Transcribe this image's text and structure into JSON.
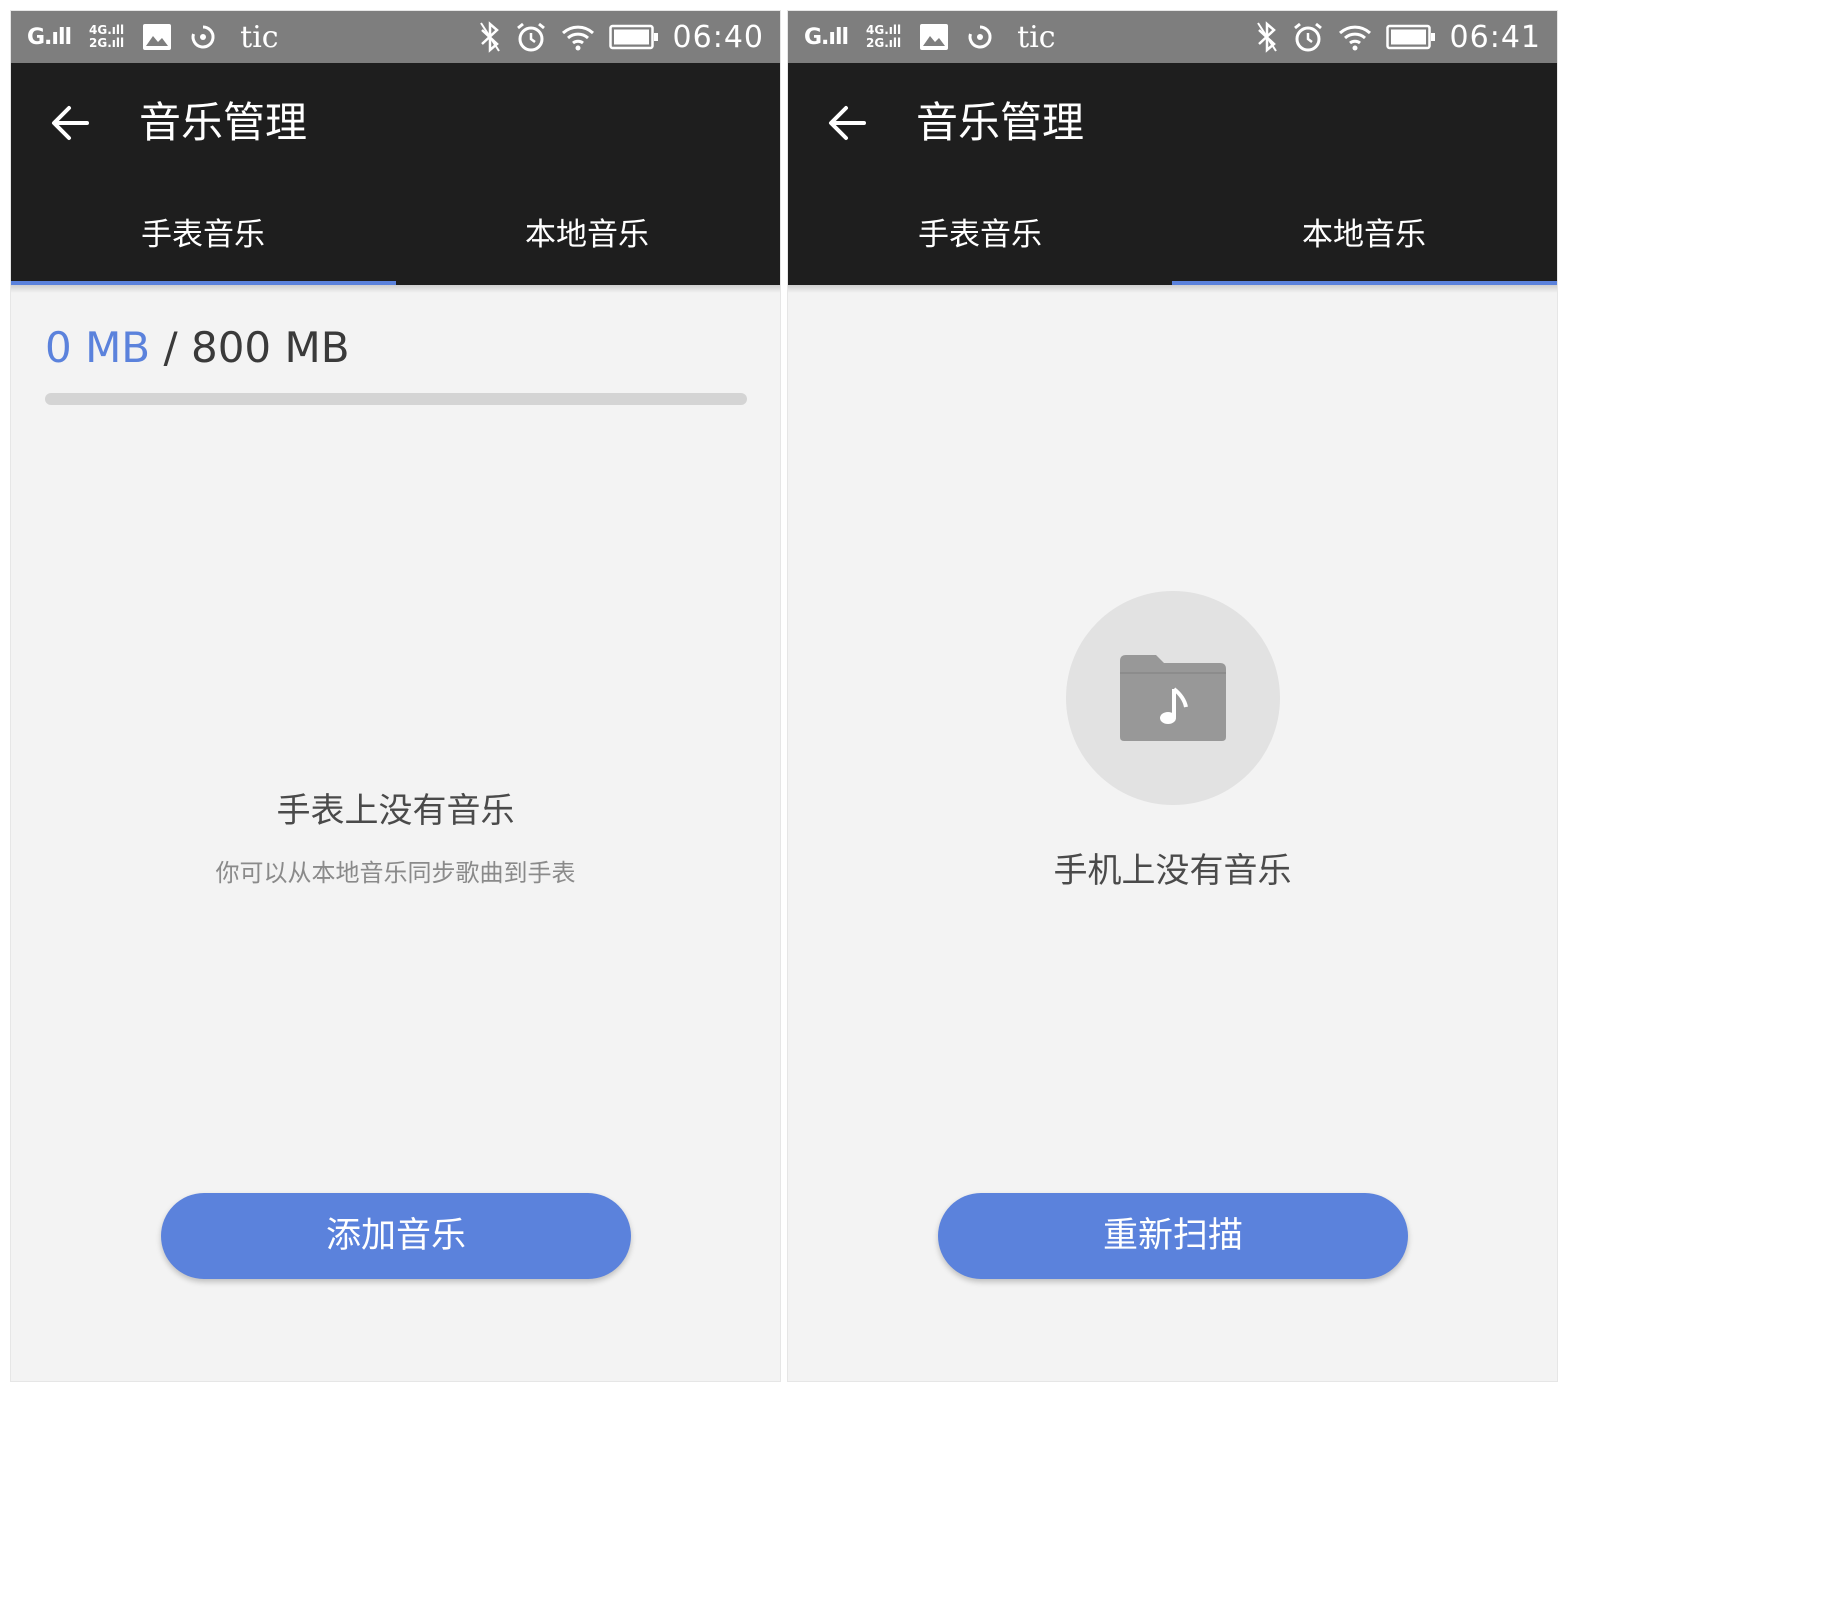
{
  "left": {
    "status_bar": {
      "signal_1": "G.ıll",
      "signal_2_top": "4G.ıll",
      "signal_2_bottom": "2G.ıll",
      "carrier": "tic",
      "time": "06:40"
    },
    "app_bar": {
      "title": "音乐管理",
      "tabs": [
        {
          "label": "手表音乐",
          "selected": true
        },
        {
          "label": "本地音乐",
          "selected": false
        }
      ]
    },
    "storage": {
      "used": "0 MB",
      "separator": " / ",
      "total": "800 MB",
      "progress_fraction": 0
    },
    "empty_state": {
      "title": "手表上没有音乐",
      "subtitle": "你可以从本地音乐同步歌曲到手表"
    },
    "action_button": "添加音乐"
  },
  "right": {
    "status_bar": {
      "signal_1": "G.ıll",
      "signal_2_top": "4G.ıll",
      "signal_2_bottom": "2G.ıll",
      "carrier": "tic",
      "time": "06:41"
    },
    "app_bar": {
      "title": "音乐管理",
      "tabs": [
        {
          "label": "手表音乐",
          "selected": false
        },
        {
          "label": "本地音乐",
          "selected": true
        }
      ]
    },
    "empty_state": {
      "icon": "music-folder-icon",
      "title": "手机上没有音乐"
    },
    "action_button": "重新扫描"
  },
  "colors": {
    "accent": "#5b82dc",
    "app_bar": "#1e1e1e",
    "status_bar": "#7e7e7e",
    "background": "#f3f3f3"
  }
}
